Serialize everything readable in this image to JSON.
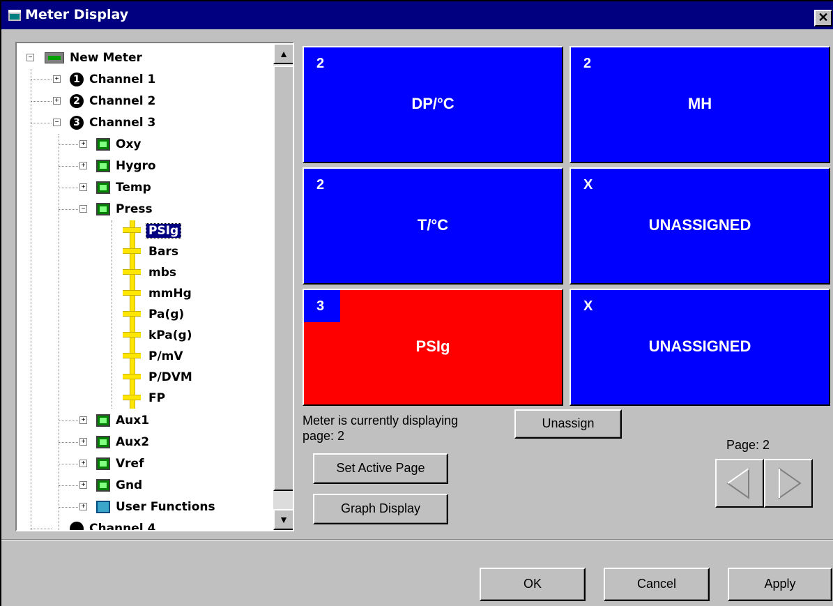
{
  "window": {
    "title": "Meter Display",
    "close_glyph": "✕"
  },
  "tree": {
    "root": "New Meter",
    "channels": [
      {
        "glyph": "1",
        "label": "Channel 1",
        "expanded": false
      },
      {
        "glyph": "2",
        "label": "Channel 2",
        "expanded": false
      },
      {
        "glyph": "3",
        "label": "Channel 3",
        "expanded": true
      }
    ],
    "sensors_before": [
      "Oxy",
      "Hygro",
      "Temp"
    ],
    "press": "Press",
    "units": [
      "PSIg",
      "Bars",
      "mbs",
      "mmHg",
      "Pa(g)",
      "kPa(g)",
      "P/mV",
      "P/DVM",
      "FP"
    ],
    "selected_unit": "PSIg",
    "sensors_after": [
      "Aux1",
      "Aux2",
      "Vref",
      "Gnd"
    ],
    "user_functions": "User Functions",
    "partial_next": "Channel 4"
  },
  "tiles": [
    {
      "num": "2",
      "label": "DP/°C",
      "active": false
    },
    {
      "num": "2",
      "label": "MH",
      "active": false
    },
    {
      "num": "2",
      "label": "T/°C",
      "active": false
    },
    {
      "num": "X",
      "label": "UNASSIGNED",
      "active": false
    },
    {
      "num": "3",
      "label": "PSIg",
      "active": true
    },
    {
      "num": "X",
      "label": "UNASSIGNED",
      "active": false
    }
  ],
  "status": {
    "line1": "Meter is currently displaying",
    "line2": "page: 2"
  },
  "buttons": {
    "unassign": "Unassign",
    "set_active_page": "Set Active Page",
    "graph_display": "Graph Display",
    "ok": "OK",
    "cancel": "Cancel",
    "apply": "Apply"
  },
  "pager": {
    "label": "Page: 2"
  },
  "colors": {
    "tile_blue": "#0000ff",
    "tile_active": "#ff0000",
    "titlebar": "#000080",
    "unit_bar": "#ffe600"
  }
}
